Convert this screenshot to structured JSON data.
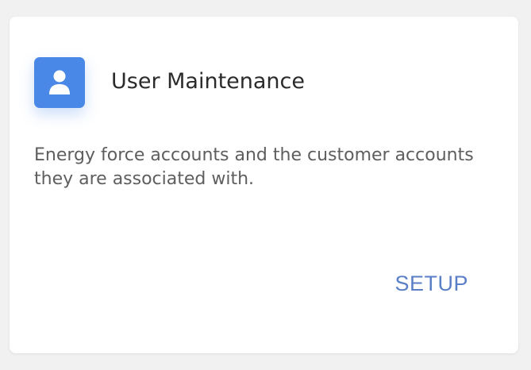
{
  "card": {
    "title": "User Maintenance",
    "description": "Energy force accounts and the customer accounts they are associated with.",
    "icon": "user-icon",
    "action_label": "SETUP"
  },
  "colors": {
    "accent": "#4a88e8",
    "link": "#5a7fc6",
    "title_text": "#2b2b2b",
    "body_text": "#5e5e5e",
    "card_bg": "#ffffff",
    "page_bg": "#f1f1f1"
  }
}
